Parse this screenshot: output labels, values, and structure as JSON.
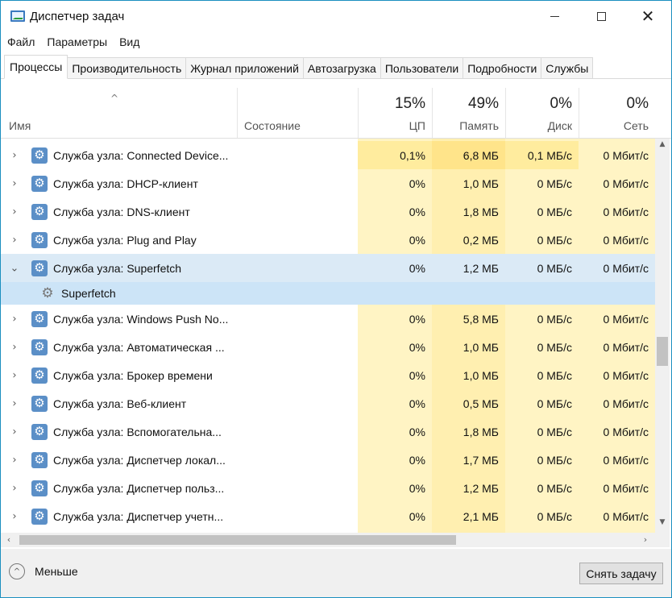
{
  "window": {
    "title": "Диспетчер задач"
  },
  "menu": [
    "Файл",
    "Параметры",
    "Вид"
  ],
  "tabs": [
    "Процессы",
    "Производительность",
    "Журнал приложений",
    "Автозагрузка",
    "Пользователи",
    "Подробности",
    "Службы"
  ],
  "active_tab": "Процессы",
  "columns": {
    "name": "Имя",
    "state": "Состояние",
    "cpu": {
      "pct": "15%",
      "label": "ЦП"
    },
    "mem": {
      "pct": "49%",
      "label": "Память"
    },
    "disk": {
      "pct": "0%",
      "label": "Диск"
    },
    "net": {
      "pct": "0%",
      "label": "Сеть"
    }
  },
  "rows": [
    {
      "name": "Служба узла: Connected Device...",
      "cpu": "0,1%",
      "mem": "6,8 МБ",
      "disk": "0,1 МБ/с",
      "net": "0 Мбит/с"
    },
    {
      "name": "Служба узла: DHCP-клиент",
      "cpu": "0%",
      "mem": "1,0 МБ",
      "disk": "0 МБ/с",
      "net": "0 Мбит/с"
    },
    {
      "name": "Служба узла: DNS-клиент",
      "cpu": "0%",
      "mem": "1,8 МБ",
      "disk": "0 МБ/с",
      "net": "0 Мбит/с"
    },
    {
      "name": "Служба узла: Plug and Play",
      "cpu": "0%",
      "mem": "0,2 МБ",
      "disk": "0 МБ/с",
      "net": "0 Мбит/с"
    },
    {
      "name": "Служба узла: Superfetch",
      "cpu": "0%",
      "mem": "1,2 МБ",
      "disk": "0 МБ/с",
      "net": "0 Мбит/с"
    },
    {
      "name": "Superfetch"
    },
    {
      "name": "Служба узла: Windows Push No...",
      "cpu": "0%",
      "mem": "5,8 МБ",
      "disk": "0 МБ/с",
      "net": "0 Мбит/с"
    },
    {
      "name": "Служба узла: Автоматическая ...",
      "cpu": "0%",
      "mem": "1,0 МБ",
      "disk": "0 МБ/с",
      "net": "0 Мбит/с"
    },
    {
      "name": "Служба узла: Брокер времени",
      "cpu": "0%",
      "mem": "1,0 МБ",
      "disk": "0 МБ/с",
      "net": "0 Мбит/с"
    },
    {
      "name": "Служба узла: Веб-клиент",
      "cpu": "0%",
      "mem": "0,5 МБ",
      "disk": "0 МБ/с",
      "net": "0 Мбит/с"
    },
    {
      "name": "Служба узла: Вспомогательна...",
      "cpu": "0%",
      "mem": "1,8 МБ",
      "disk": "0 МБ/с",
      "net": "0 Мбит/с"
    },
    {
      "name": "Служба узла: Диспетчер локал...",
      "cpu": "0%",
      "mem": "1,7 МБ",
      "disk": "0 МБ/с",
      "net": "0 Мбит/с"
    },
    {
      "name": "Служба узла: Диспетчер польз...",
      "cpu": "0%",
      "mem": "1,2 МБ",
      "disk": "0 МБ/с",
      "net": "0 Мбит/с"
    },
    {
      "name": "Служба узла: Диспетчер учетн...",
      "cpu": "0%",
      "mem": "2,1 МБ",
      "disk": "0 МБ/с",
      "net": "0 Мбит/с"
    }
  ],
  "footer": {
    "less_label": "Меньше",
    "end_task_label": "Снять задачу"
  },
  "colors": {
    "accent_border": "#1b8fbf",
    "cpu_highlight": "#ffec9e",
    "column_tint": "#fff4c4",
    "selected_row": "#cce4f7",
    "expanded_row": "#dbeaf6"
  }
}
